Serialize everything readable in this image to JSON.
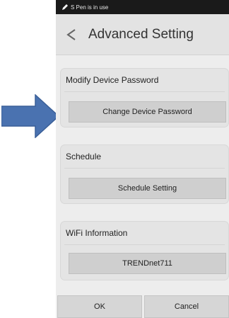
{
  "status_bar": {
    "text": "S Pen is in use",
    "icon": "pen-icon"
  },
  "header": {
    "back_icon": "back-arrow-icon",
    "title": "Advanced Setting"
  },
  "sections": [
    {
      "label": "Modify Device Password",
      "button_label": "Change Device Password"
    },
    {
      "label": "Schedule",
      "button_label": "Schedule Setting"
    },
    {
      "label": "WiFi Information",
      "button_label": "TRENDnet711"
    }
  ],
  "footer": {
    "ok_label": "OK",
    "cancel_label": "Cancel"
  },
  "annotation": {
    "icon": "pointer-arrow-icon",
    "color": "#4a72b0"
  }
}
